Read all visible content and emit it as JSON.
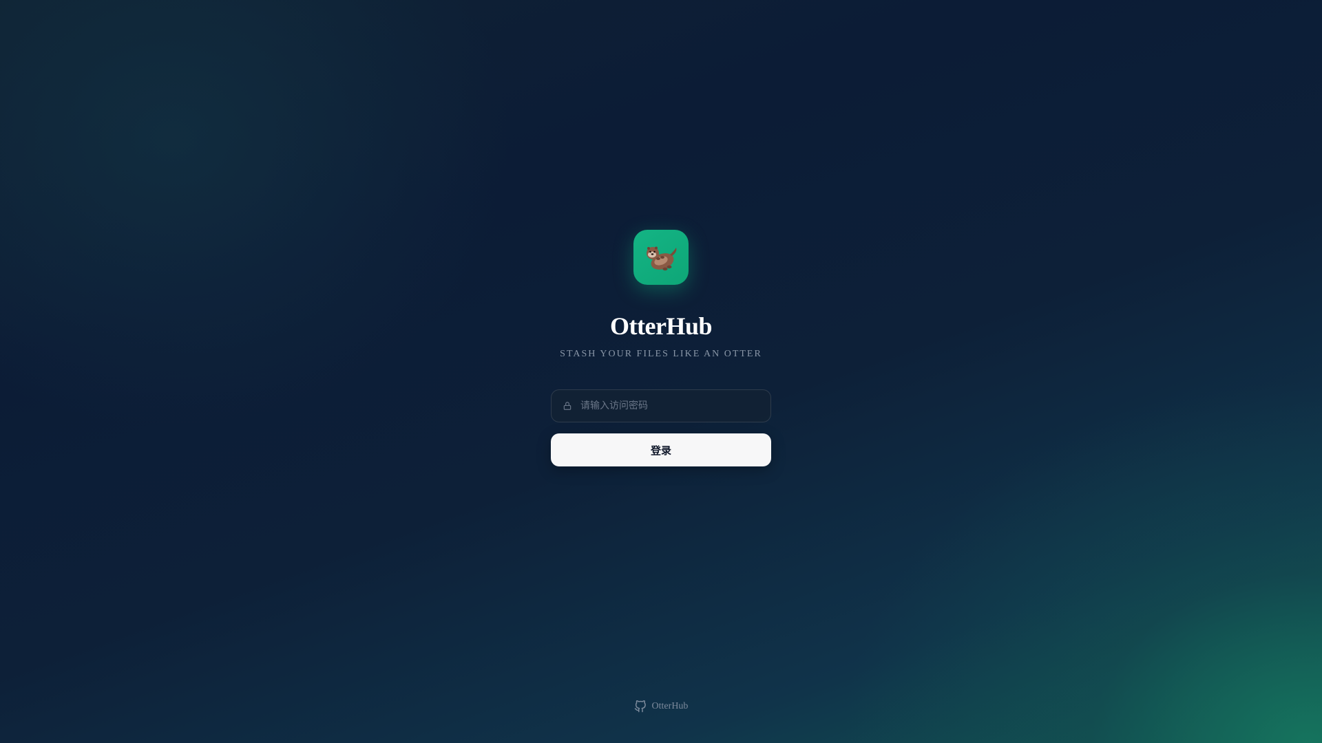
{
  "app": {
    "title": "OtterHub",
    "tagline": "STASH YOUR FILES LIKE AN OTTER",
    "logo_icon": "otter-icon",
    "accent_color": "#10b981"
  },
  "login": {
    "password_placeholder": "请输入访问密码",
    "password_value": "",
    "lock_icon": "lock-icon",
    "submit_label": "登录"
  },
  "footer": {
    "link_label": "OtterHub",
    "link_icon": "github-icon"
  }
}
